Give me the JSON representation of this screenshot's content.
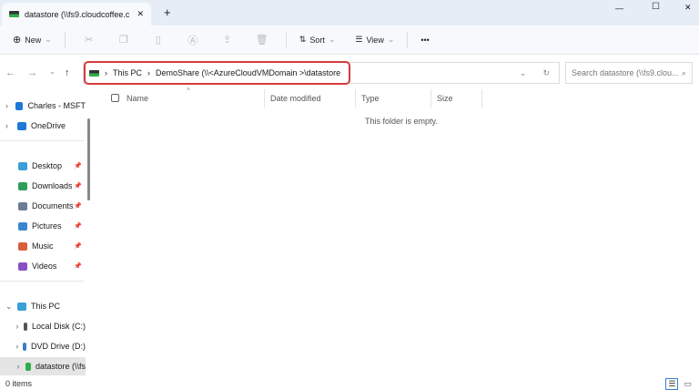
{
  "tab": {
    "title": "datastore (\\\\fs9.cloudcoffee.c",
    "close": "✕",
    "new_tab": "+"
  },
  "window": {
    "minimize": "—",
    "maximize": "☐",
    "close": "✕"
  },
  "toolbar": {
    "new": "New",
    "sort": "Sort",
    "view": "View",
    "more": "•••"
  },
  "address": {
    "segments": [
      "This PC",
      "DemoShare (\\\\<AzureCloudVMDomain >\\datastore"
    ]
  },
  "search": {
    "placeholder": "Search datastore (\\\\fs9.clou..."
  },
  "columns": [
    "Name",
    "Date modified",
    "Type",
    "Size"
  ],
  "empty_message": "This folder is empty.",
  "sidebar": {
    "items": [
      {
        "label": "Charles - MSFT",
        "icon": "cloud-icon",
        "color": "#1e78d6"
      },
      {
        "label": "OneDrive",
        "icon": "cloud-icon",
        "color": "#1e78d6"
      },
      {
        "label": "Desktop",
        "icon": "desktop-icon",
        "color": "#3aa0d8"
      },
      {
        "label": "Downloads",
        "icon": "download-icon",
        "color": "#2f9e57"
      },
      {
        "label": "Documents",
        "icon": "document-icon",
        "color": "#6b7c93"
      },
      {
        "label": "Pictures",
        "icon": "pictures-icon",
        "color": "#3a86d0"
      },
      {
        "label": "Music",
        "icon": "music-icon",
        "color": "#d9603b"
      },
      {
        "label": "Videos",
        "icon": "video-icon",
        "color": "#8a4fc4"
      },
      {
        "label": "This PC",
        "icon": "computer-icon",
        "color": "#3aa0d8"
      },
      {
        "label": "Local Disk (C:)",
        "icon": "disk-icon",
        "color": "#555"
      },
      {
        "label": "DVD Drive (D:)",
        "icon": "dvd-icon",
        "color": "#3a7fc4"
      },
      {
        "label": "datastore (\\\\fs",
        "icon": "network-drive-icon",
        "color": "#2fae4a"
      }
    ]
  },
  "status": {
    "items": "0 items"
  }
}
